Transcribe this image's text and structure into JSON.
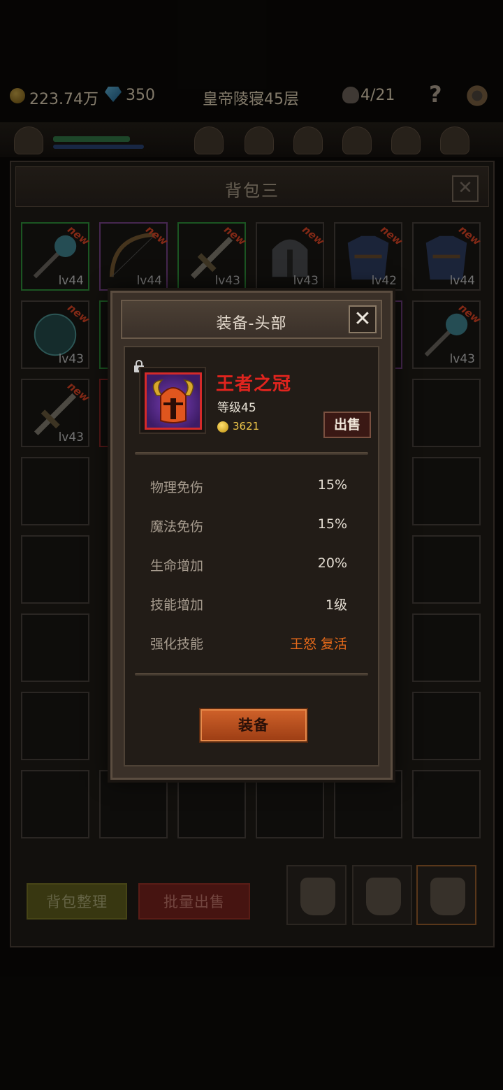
{
  "topbar": {
    "gold": "223.74万",
    "gems": "350",
    "stage": "皇帝陵寝45层",
    "keys": "4/21",
    "help": "?"
  },
  "backpack": {
    "title": "背包三",
    "close": "✕",
    "slots": [
      {
        "lv": "lv44",
        "new": "new",
        "rarity": "green"
      },
      {
        "lv": "lv44",
        "new": "new",
        "rarity": "purple"
      },
      {
        "lv": "lv43",
        "new": "new",
        "rarity": "green"
      },
      {
        "lv": "lv43",
        "new": "new",
        "rarity": "gray"
      },
      {
        "lv": "lv42",
        "new": "new",
        "rarity": "gray"
      },
      {
        "lv": "lv44",
        "new": "new",
        "rarity": "gray"
      },
      {
        "lv": "lv43",
        "new": "new",
        "rarity": "gray"
      },
      {
        "lv": "lv43",
        "new": "new",
        "rarity": "gray"
      },
      {
        "lv": "lv43",
        "new": "new",
        "rarity": "gray"
      }
    ],
    "sort_label": "背包整理",
    "batch_sell_label": "批量出售"
  },
  "modal": {
    "title": "装备-头部",
    "close": "✕",
    "item": {
      "name": "王者之冠",
      "level": "等级45",
      "price": "3621",
      "sell_label": "出售"
    },
    "stats": [
      {
        "label": "物理免伤",
        "value": "15%"
      },
      {
        "label": "魔法免伤",
        "value": "15%"
      },
      {
        "label": "生命增加",
        "value": "20%"
      },
      {
        "label": "技能增加",
        "value": "1级"
      },
      {
        "label": "强化技能",
        "value": "王怒 复活"
      }
    ],
    "equip_label": "装备"
  },
  "colors": {
    "item_name": "#e0241e",
    "equip_button": "#c0561e",
    "highlight_orange": "#e66a1a"
  }
}
